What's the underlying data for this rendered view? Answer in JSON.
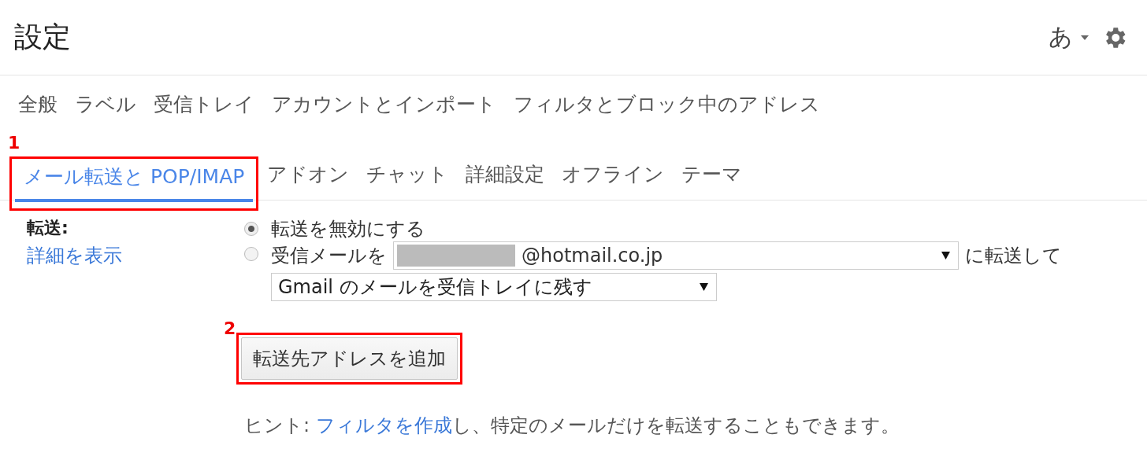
{
  "header": {
    "title": "設定",
    "input_tool": "あ"
  },
  "tab_rows": [
    [
      {
        "label": "全般",
        "selected": false
      },
      {
        "label": "ラベル",
        "selected": false
      },
      {
        "label": "受信トレイ",
        "selected": false
      },
      {
        "label": "アカウントとインポート",
        "selected": false
      },
      {
        "label": "フィルタとブロック中のアドレス",
        "selected": false
      }
    ],
    [
      {
        "label": "メール転送と POP/IMAP",
        "selected": true,
        "callout": "1"
      },
      {
        "label": "アドオン",
        "selected": false
      },
      {
        "label": "チャット",
        "selected": false
      },
      {
        "label": "詳細設定",
        "selected": false
      },
      {
        "label": "オフライン",
        "selected": false
      },
      {
        "label": "テーマ",
        "selected": false
      }
    ]
  ],
  "forwarding": {
    "label": "転送:",
    "details_link": "詳細を表示",
    "options": [
      {
        "label": "転送を無効にする",
        "selected": true
      },
      {
        "label": "受信メールを",
        "selected": false,
        "address": "@hotmail.co.jp",
        "after": "に転送して",
        "action": "Gmail のメールを受信トレイに残す"
      }
    ],
    "add_button": {
      "label": "転送先アドレスを追加",
      "callout": "2"
    },
    "hint": {
      "prefix": "ヒント: ",
      "link": "フィルタを作成",
      "suffix": "し、特定のメールだけを転送することもできます。"
    }
  }
}
